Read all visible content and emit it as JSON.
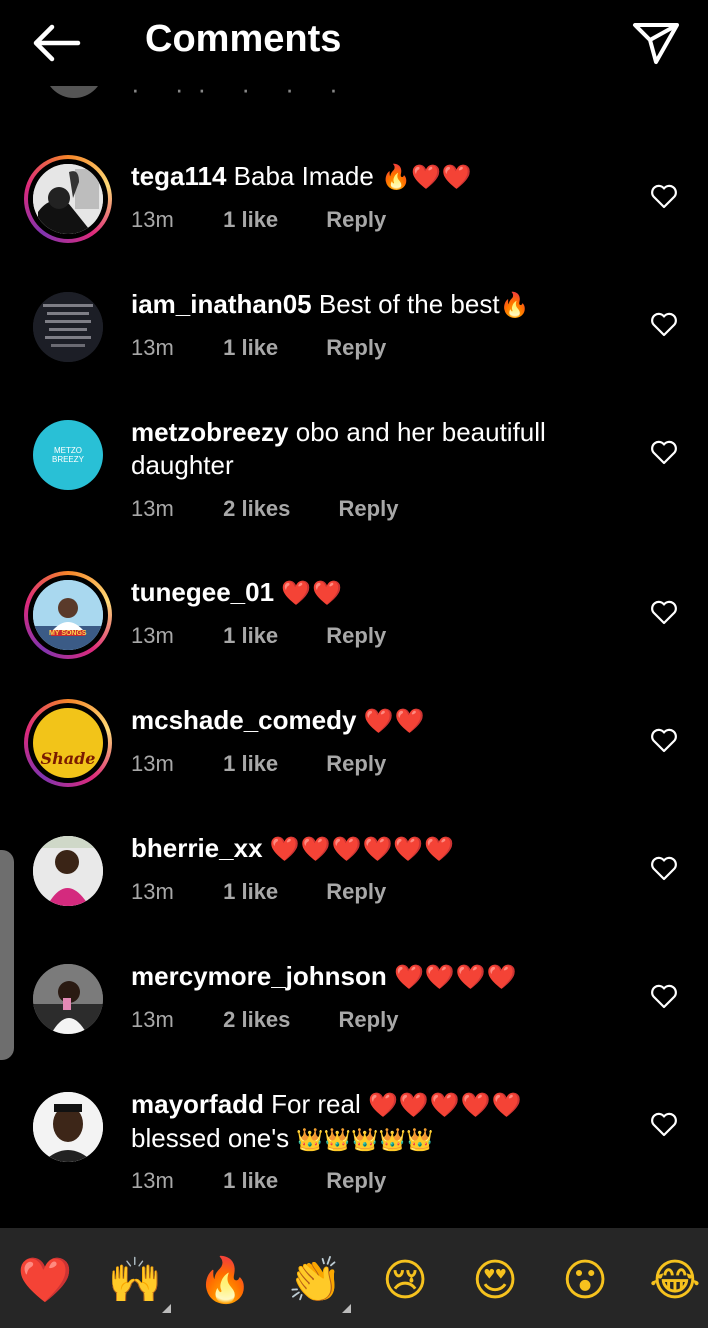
{
  "header": {
    "title": "Comments",
    "back_icon": "arrow-left-icon",
    "send_icon": "paper-plane-icon"
  },
  "comments": [
    {
      "username": "tega114",
      "text": "Baba Imade",
      "emoji": [
        "🔥",
        "❤️",
        "❤️"
      ],
      "time": "13m",
      "likes": "1 like",
      "reply": "Reply",
      "story_ring": true
    },
    {
      "username": "iam_inathan05",
      "text": "Best of the best",
      "emoji": [
        "🔥"
      ],
      "time": "13m",
      "likes": "1 like",
      "reply": "Reply",
      "story_ring": false
    },
    {
      "username": "metzobreezy",
      "text": "obo and her beautifull daughter",
      "emoji": [],
      "time": "13m",
      "likes": "2 likes",
      "reply": "Reply",
      "story_ring": false,
      "avatar_text": "METZO BREEZY"
    },
    {
      "username": "tunegee_01",
      "text": "",
      "emoji": [
        "❤️",
        "❤️"
      ],
      "time": "13m",
      "likes": "1 like",
      "reply": "Reply",
      "story_ring": true,
      "avatar_text": "MY SONGS"
    },
    {
      "username": "mcshade_comedy",
      "text": "",
      "emoji": [
        "❤️",
        "❤️"
      ],
      "time": "13m",
      "likes": "1 like",
      "reply": "Reply",
      "story_ring": true,
      "avatar_text": "Shade"
    },
    {
      "username": "bherrie_xx",
      "text": "",
      "emoji": [
        "❤️",
        "❤️",
        "❤️",
        "❤️",
        "❤️",
        "❤️"
      ],
      "time": "13m",
      "likes": "1 like",
      "reply": "Reply",
      "story_ring": false
    },
    {
      "username": "mercymore_johnson",
      "text": "",
      "emoji": [
        "❤️",
        "❤️",
        "❤️",
        "❤️"
      ],
      "time": "13m",
      "likes": "2 likes",
      "reply": "Reply",
      "story_ring": false
    },
    {
      "username": "mayorfadd",
      "text": "For real",
      "emoji": [
        "❤️",
        "❤️",
        "❤️",
        "❤️",
        "❤️"
      ],
      "text2": "blessed one's",
      "emoji2": [
        "👑",
        "👑",
        "👑",
        "👑",
        "👑"
      ],
      "time": "13m",
      "likes": "1 like",
      "reply": "Reply",
      "story_ring": false
    }
  ],
  "reactions": [
    "❤️",
    "🙌",
    "🔥",
    "👏",
    "😢",
    "😍",
    "😮",
    "😂"
  ],
  "colors": {
    "background": "#000000",
    "secondary_text": "#a8a8a8",
    "reaction_bar": "#262626",
    "heart_red": "#e8192c"
  }
}
